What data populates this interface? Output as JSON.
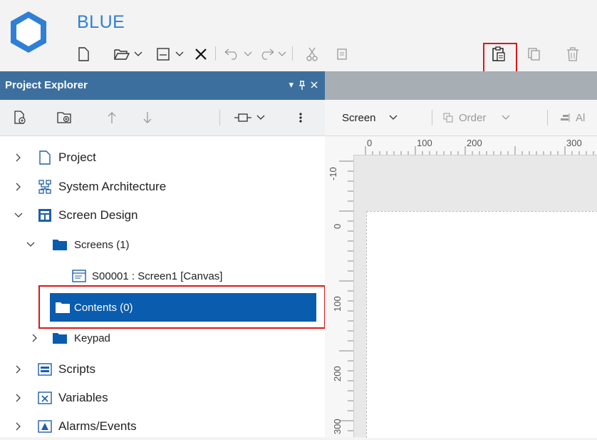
{
  "app": {
    "title": "BLUE",
    "brand_color": "#2f7fd6"
  },
  "toolbar": {
    "items": [
      "new-file-icon",
      "open-folder-icon",
      "save-icon",
      "close-icon",
      "undo-icon",
      "redo-icon",
      "cut-icon",
      "copy-icon",
      "paste-icon",
      "duplicate-icon",
      "delete-icon"
    ]
  },
  "explorer": {
    "title": "Project Explorer",
    "pin_glyph": "▾",
    "tree": [
      {
        "label": "Project",
        "level": 0,
        "icon": "page-icon",
        "expanded": false
      },
      {
        "label": "System Architecture",
        "level": 0,
        "icon": "network-icon",
        "expanded": false
      },
      {
        "label": "Screen Design",
        "level": 0,
        "icon": "screen-design-icon",
        "expanded": true
      },
      {
        "label": "Screens (1)",
        "level": 1,
        "icon": "folder-icon",
        "expanded": true
      },
      {
        "label": "S00001 : Screen1 [Canvas]",
        "level": 2,
        "icon": "screen-icon"
      },
      {
        "label": "Contents (0)",
        "level": 1,
        "icon": "folder-icon",
        "selected": true
      },
      {
        "label": "Keypad",
        "level": 1,
        "icon": "folder-icon",
        "expanded": false
      },
      {
        "label": "Scripts",
        "level": 0,
        "icon": "scripts-icon",
        "expanded": false
      },
      {
        "label": "Variables",
        "level": 0,
        "icon": "variables-icon",
        "expanded": false
      },
      {
        "label": "Alarms/Events",
        "level": 0,
        "icon": "alarm-icon",
        "expanded": false
      }
    ]
  },
  "designer": {
    "screen_label": "Screen",
    "order_label": "Order",
    "align_label": "Al",
    "ruler_h": [
      "0",
      "100",
      "200",
      "300"
    ],
    "ruler_v": [
      "-10",
      "0",
      "100",
      "200",
      "300"
    ]
  },
  "colors": {
    "panel_header": "#3c6f9e",
    "selection": "#0a5cae",
    "highlight": "#e01616"
  }
}
